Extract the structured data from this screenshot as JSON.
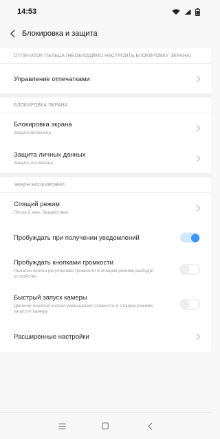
{
  "status_bar": {
    "time": "14:53",
    "icons": [
      "wifi-icon",
      "signal-icon",
      "battery-icon"
    ]
  },
  "header": {
    "title": "Блокировка и защита"
  },
  "sections": {
    "fingerprint": {
      "header": "ОТПЕЧАТОК ПАЛЬЦА (НЕОБХОДИМО НАСТРОИТЬ БЛОКИРОВКУ ЭКРАНА)",
      "items": [
        {
          "title": "Управление отпечатками"
        }
      ]
    },
    "screen_lock": {
      "header": "БЛОКИРОВКА ЭКРАНА",
      "items": [
        {
          "title": "Блокировка экрана",
          "subtitle": "Защита включена"
        },
        {
          "title": "Защита личных данных",
          "subtitle": "Защита отключена"
        }
      ]
    },
    "lock_screen": {
      "header": "ЭКРАН БЛОКИРОВКИ",
      "items": [
        {
          "title": "Спящий режим",
          "subtitle": "После 5 мин. бездействия"
        },
        {
          "title": "Пробуждать при получении уведомлений",
          "toggle": true
        },
        {
          "title": "Пробуждать кнопками громкости",
          "subtitle": "Нажатие кнопки регулировки громкости в спящем режиме разбудит устройство",
          "toggle": false
        },
        {
          "title": "Быстрый запуск камеры",
          "subtitle": "Двойное нажатие кнопки уменьшения громкости в спящем режиме запустит камеру",
          "toggle": false
        },
        {
          "title": "Расширенные настройки"
        }
      ]
    }
  },
  "colors": {
    "accent": "#3a94f0",
    "background": "#f7f7f7",
    "secondary_text": "#9a9a9a"
  }
}
